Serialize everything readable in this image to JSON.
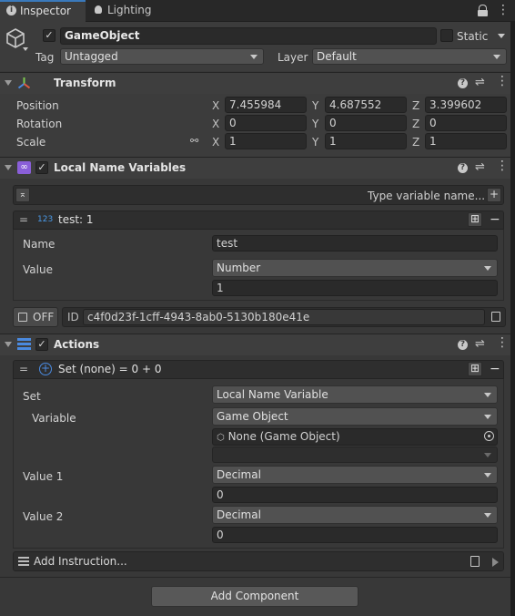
{
  "tabs": [
    {
      "label": "Inspector",
      "icon": "info-icon"
    },
    {
      "label": "Lighting",
      "icon": "bulb-icon"
    }
  ],
  "object": {
    "name": "GameObject",
    "static_label": "Static",
    "tag_label": "Tag",
    "tag_value": "Untagged",
    "layer_label": "Layer",
    "layer_value": "Default"
  },
  "transform": {
    "title": "Transform",
    "rows": [
      {
        "label": "Position",
        "x": "7.455984",
        "y": "4.687552",
        "z": "3.399602"
      },
      {
        "label": "Rotation",
        "x": "0",
        "y": "0",
        "z": "0"
      },
      {
        "label": "Scale",
        "x": "1",
        "y": "1",
        "z": "1"
      }
    ],
    "axes": [
      "X",
      "Y",
      "Z"
    ]
  },
  "local_vars": {
    "title": "Local Name Variables",
    "type_placeholder": "Type variable name...",
    "item_badge": "123",
    "item_title": "test: 1",
    "name_label": "Name",
    "name_value": "test",
    "value_label": "Value",
    "value_type": "Number",
    "value_value": "1",
    "off_label": "OFF",
    "id_label": "ID",
    "id_value": "c4f0d23f-1cff-4943-8ab0-5130b180e41e"
  },
  "actions": {
    "title": "Actions",
    "item_title": "Set (none) = 0 + 0",
    "set_label": "Set",
    "set_value": "Local Name Variable",
    "variable_label": "Variable",
    "variable_value": "Game Object",
    "object_field": "None (Game Object)",
    "value1_label": "Value 1",
    "value1_type": "Decimal",
    "value1_value": "0",
    "value2_label": "Value 2",
    "value2_type": "Decimal",
    "value2_value": "0",
    "add_instruction": "Add Instruction..."
  },
  "footer": {
    "add_component": "Add Component"
  },
  "colors": {
    "background": "#383838",
    "accent_purple": "#8a5fd8",
    "accent_blue": "#4a8ae0",
    "transform_icon": "#e0a040"
  }
}
